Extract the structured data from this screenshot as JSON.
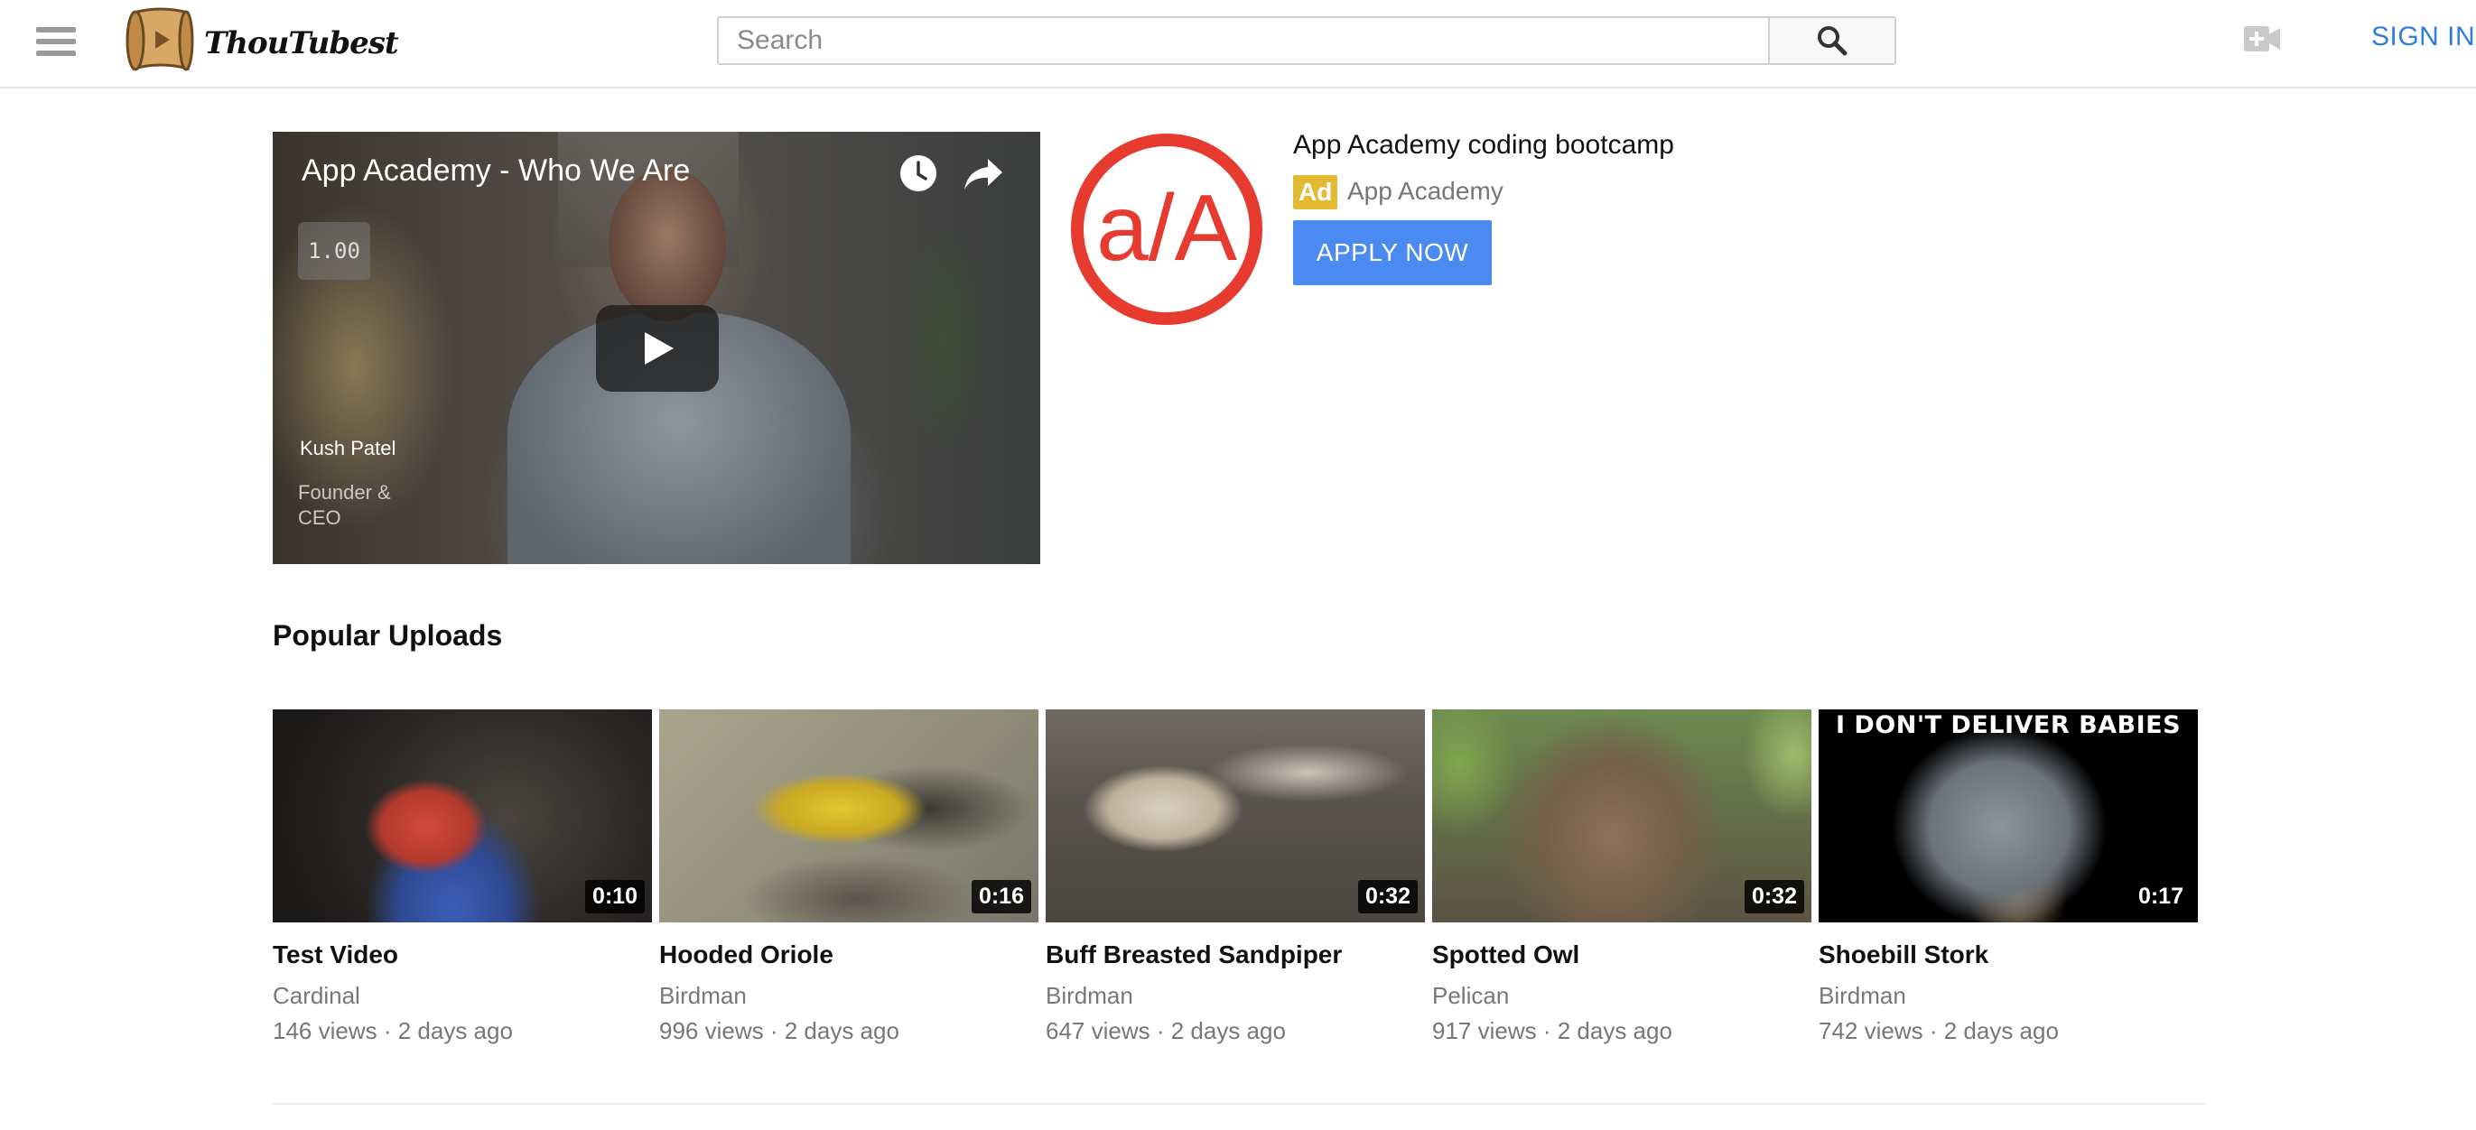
{
  "app": {
    "name": "ThouTubest"
  },
  "header": {
    "search_placeholder": "Search",
    "sign_in_label": "SIGN IN"
  },
  "featured": {
    "title": "App Academy - Who We Are",
    "speed": "1.00",
    "speaker_name": "Kush Patel",
    "speaker_role": "Founder & CEO"
  },
  "ad": {
    "title": "App Academy coding bootcamp",
    "badge": "Ad",
    "advertiser": "App Academy",
    "cta_label": "APPLY NOW",
    "logo_text": "a/A",
    "brand_color": "#e63b2e"
  },
  "popular": {
    "heading": "Popular Uploads",
    "videos": [
      {
        "title": "Test Video",
        "channel": "Cardinal",
        "meta": "146 views · 2 days ago",
        "duration": "0:10"
      },
      {
        "title": "Hooded Oriole",
        "channel": "Birdman",
        "meta": "996 views · 2 days ago",
        "duration": "0:16"
      },
      {
        "title": "Buff Breasted Sandpiper",
        "channel": "Birdman",
        "meta": "647 views · 2 days ago",
        "duration": "0:32"
      },
      {
        "title": "Spotted Owl",
        "channel": "Pelican",
        "meta": "917 views · 2 days ago",
        "duration": "0:32"
      },
      {
        "title": "Shoebill Stork",
        "channel": "Birdman",
        "meta": "742 views · 2 days ago",
        "duration": "0:17",
        "overlay_text": "I DON'T DELIVER BABIES"
      }
    ]
  },
  "colors": {
    "accent": "#2f7fd8",
    "apply_button": "#4b8af0",
    "ad_badge": "#e4b934"
  }
}
